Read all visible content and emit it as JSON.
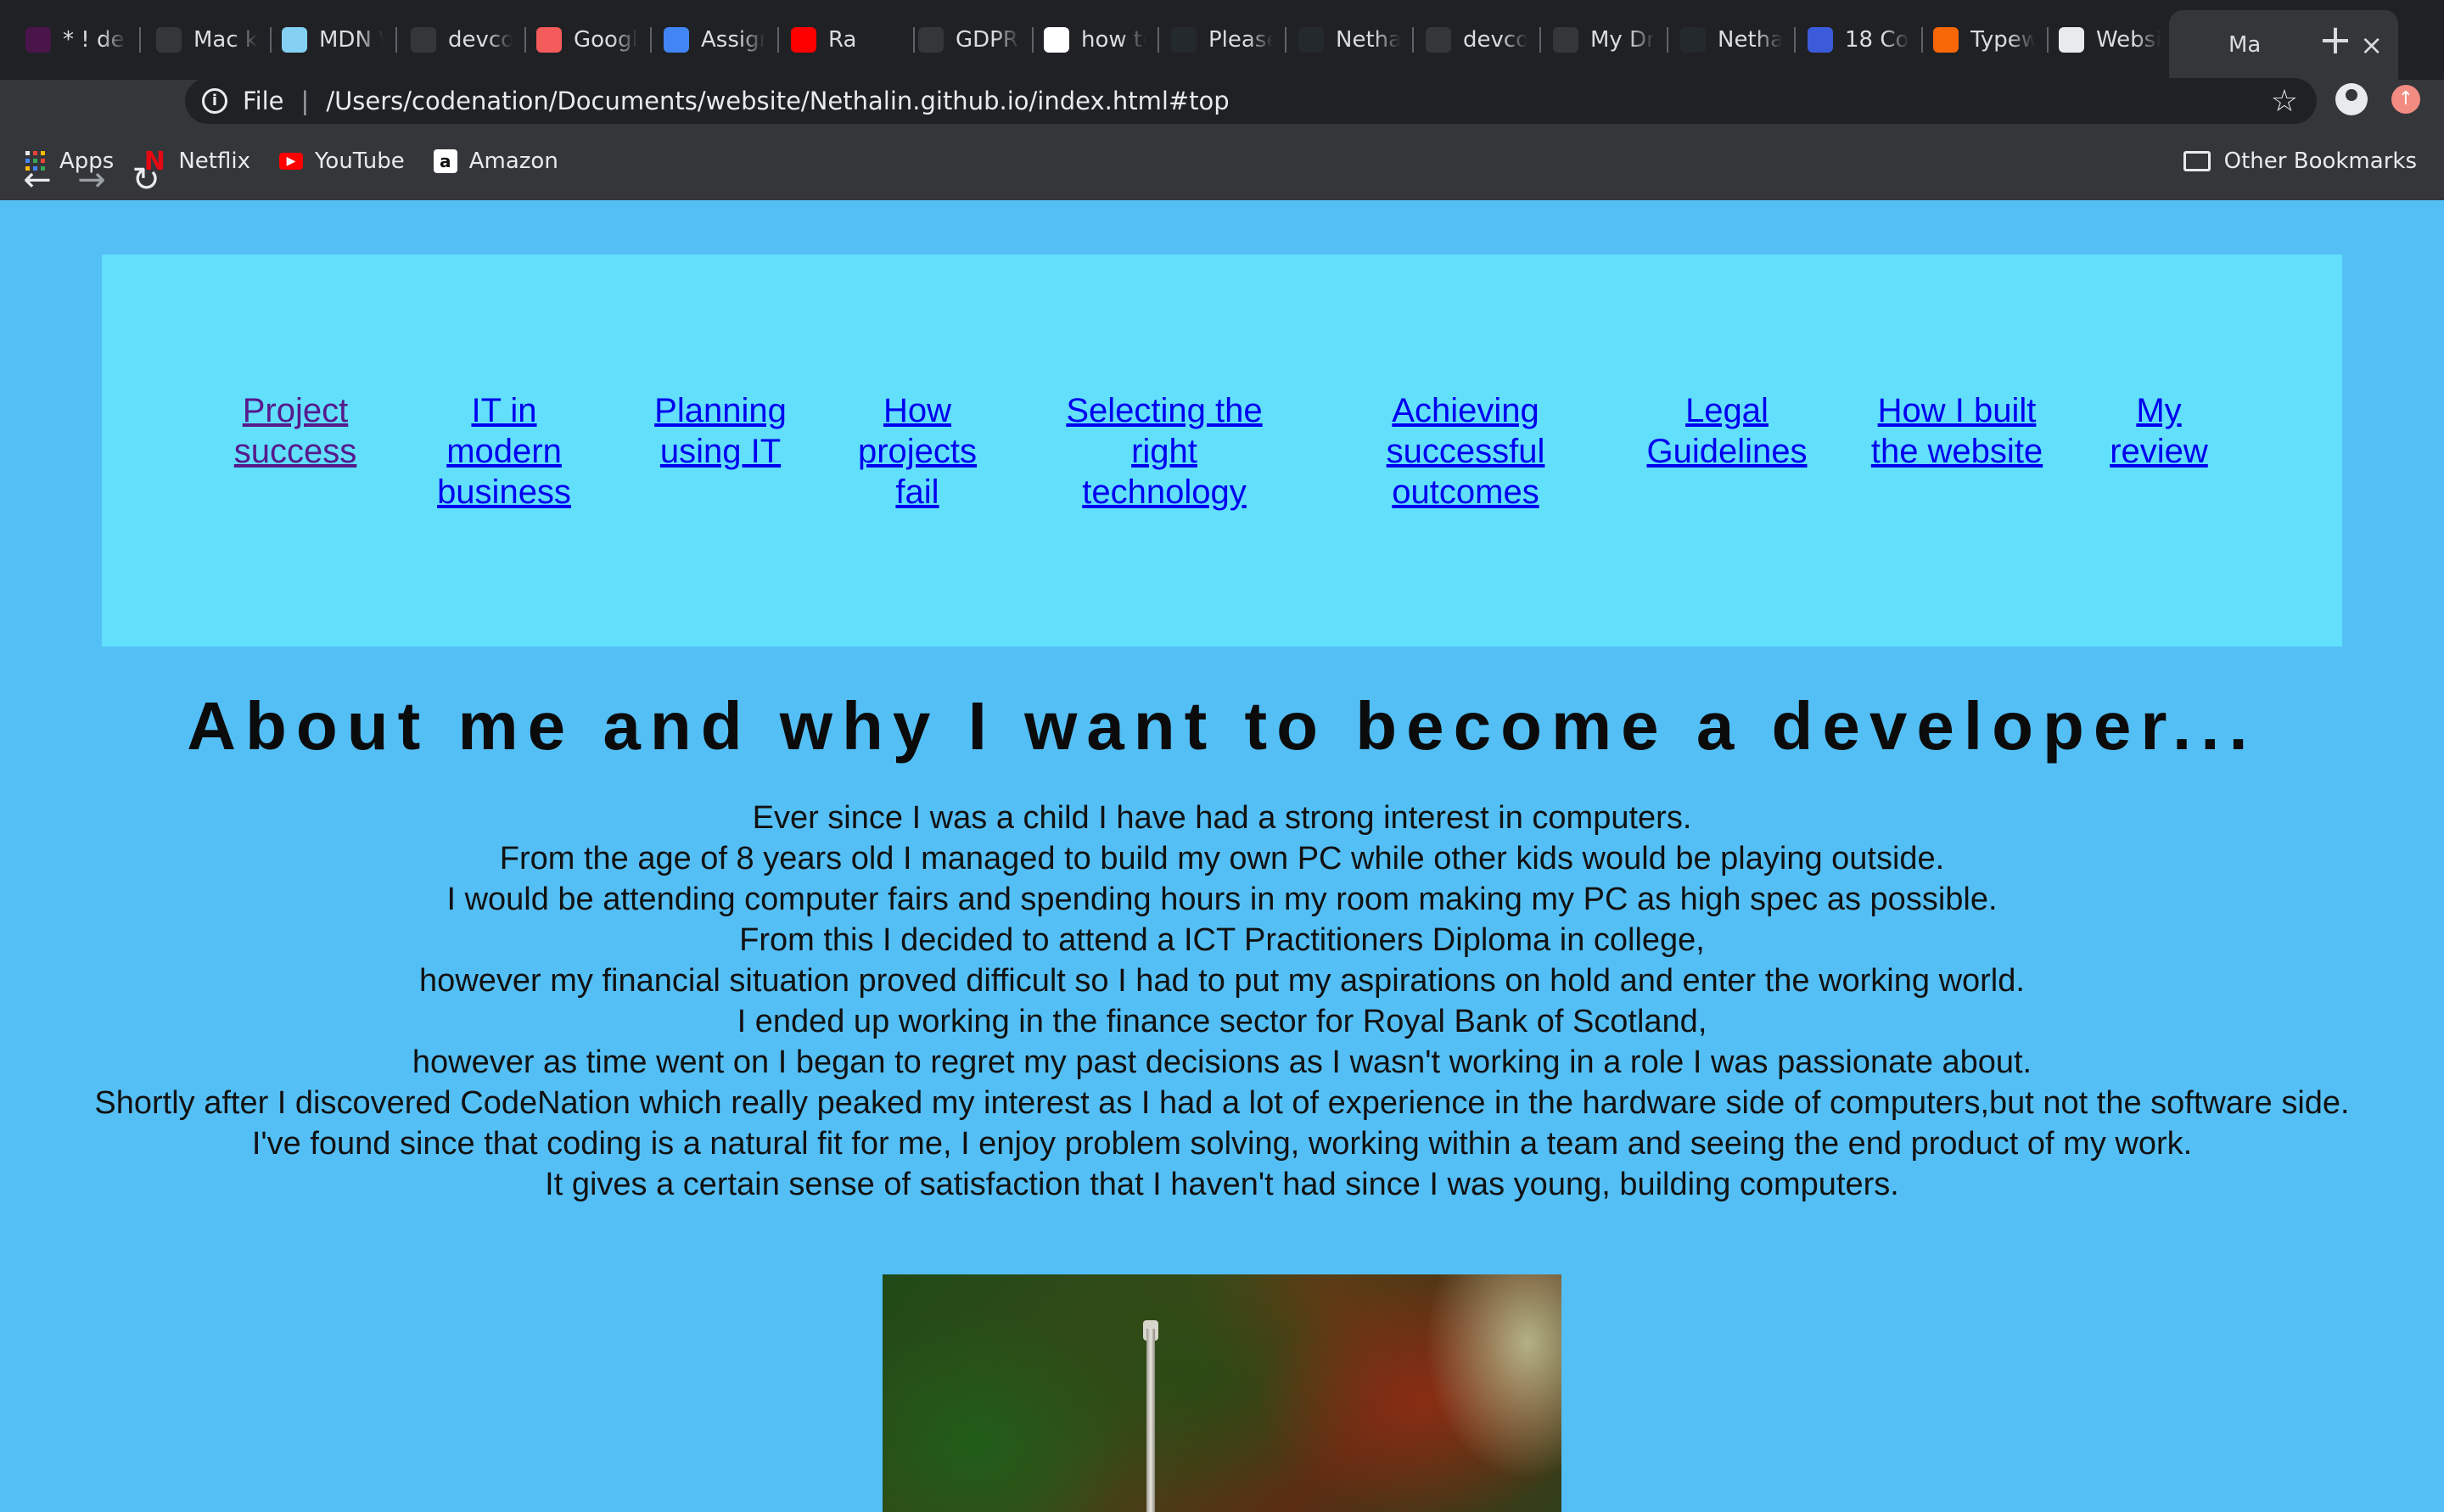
{
  "browser": {
    "tabs": [
      {
        "title": "* ! dev",
        "icon": "slack-icon",
        "color": "#4a154b"
      },
      {
        "title": "Mac k",
        "icon": "apple-icon",
        "color": "#35363a"
      },
      {
        "title": "MDN W",
        "icon": "mdn-icon",
        "color": "#83d0f2"
      },
      {
        "title": "devco",
        "icon": "globe-icon",
        "color": "#35363a"
      },
      {
        "title": "Googl",
        "icon": "forms-icon",
        "color": "#f45b5b"
      },
      {
        "title": "Assign",
        "icon": "docs-icon",
        "color": "#4285f4"
      },
      {
        "title": "Ra",
        "icon": "youtube-icon",
        "color": "#ff0000"
      },
      {
        "title": "GDPR",
        "icon": "globe-icon",
        "color": "#35363a"
      },
      {
        "title": "how to",
        "icon": "google-icon",
        "color": "#ffffff"
      },
      {
        "title": "Please",
        "icon": "github-icon",
        "color": "#24292e"
      },
      {
        "title": "Netha",
        "icon": "github-icon",
        "color": "#24292e"
      },
      {
        "title": "devco",
        "icon": "globe-icon",
        "color": "#35363a"
      },
      {
        "title": "My Dr",
        "icon": "drive-icon",
        "color": "#35363a"
      },
      {
        "title": "Netha",
        "icon": "github-icon",
        "color": "#24292e"
      },
      {
        "title": "18 Co",
        "icon": "h-icon",
        "color": "#3b5bdb"
      },
      {
        "title": "Typew",
        "icon": "typewolf-icon",
        "color": "#f76707"
      },
      {
        "title": "Websi",
        "icon": "tiles-icon",
        "color": "#e8eaed"
      },
      {
        "title": "Ma",
        "icon": "globe-icon",
        "color": "#35363a"
      }
    ],
    "url": "/Users/codenation/Documents/website/Nethalin.github.io/index.html#top",
    "url_scheme": "File",
    "bookmarks": [
      {
        "label": "Apps",
        "icon": "apps-grid-icon",
        "color": "#e8eaed"
      },
      {
        "label": "Netflix",
        "icon": "netflix-icon",
        "color": "#e50914"
      },
      {
        "label": "YouTube",
        "icon": "youtube-icon",
        "color": "#ff0000"
      },
      {
        "label": "Amazon",
        "icon": "amazon-icon",
        "color": "#ffffff"
      }
    ],
    "other_bookmarks": "Other Bookmarks"
  },
  "page": {
    "background": "#54bff5",
    "nav_background": "#61dffb",
    "nav": [
      {
        "lines": [
          "Project",
          "success"
        ],
        "visited": true
      },
      {
        "lines": [
          "IT in",
          "modern",
          "business"
        ],
        "visited": false
      },
      {
        "lines": [
          "Planning",
          "using IT"
        ],
        "visited": false
      },
      {
        "lines": [
          "How",
          "projects",
          "fail"
        ],
        "visited": false
      },
      {
        "lines": [
          "Selecting the",
          "right",
          "technology"
        ],
        "visited": false
      },
      {
        "lines": [
          "Achieving",
          "successful",
          "outcomes"
        ],
        "visited": false
      },
      {
        "lines": [
          "Legal",
          "Guidelines"
        ],
        "visited": false
      },
      {
        "lines": [
          "How I built",
          "the website"
        ],
        "visited": false
      },
      {
        "lines": [
          "My",
          "review"
        ],
        "visited": false
      }
    ],
    "heading": "About me and why I want to become a developer...",
    "about": [
      "Ever since I was a child I have had a strong interest in computers.",
      "From the age of 8 years old I managed to build my own PC while other kids would be playing outside.",
      "I would be attending computer fairs and spending hours in my room making my PC as high spec as possible.",
      "From this I decided to attend a ICT Practitioners Diploma in college,",
      "however my financial situation proved difficult so I had to put my aspirations on hold and enter the working world.",
      "I ended up working in the finance sector for Royal Bank of Scotland,",
      "however as time went on I began to regret my past decisions as I wasn't working in a role I was passionate about.",
      "Shortly after I discovered CodeNation which really peaked my interest as I had a lot of experience in the hardware side of computers,but not the software side.",
      "I've found since that coding is a natural fit for me, I enjoy problem solving, working within a team and seeing the end product of my work.",
      "It gives a certain sense of satisfaction that I haven't had since I was young, building computers."
    ]
  }
}
